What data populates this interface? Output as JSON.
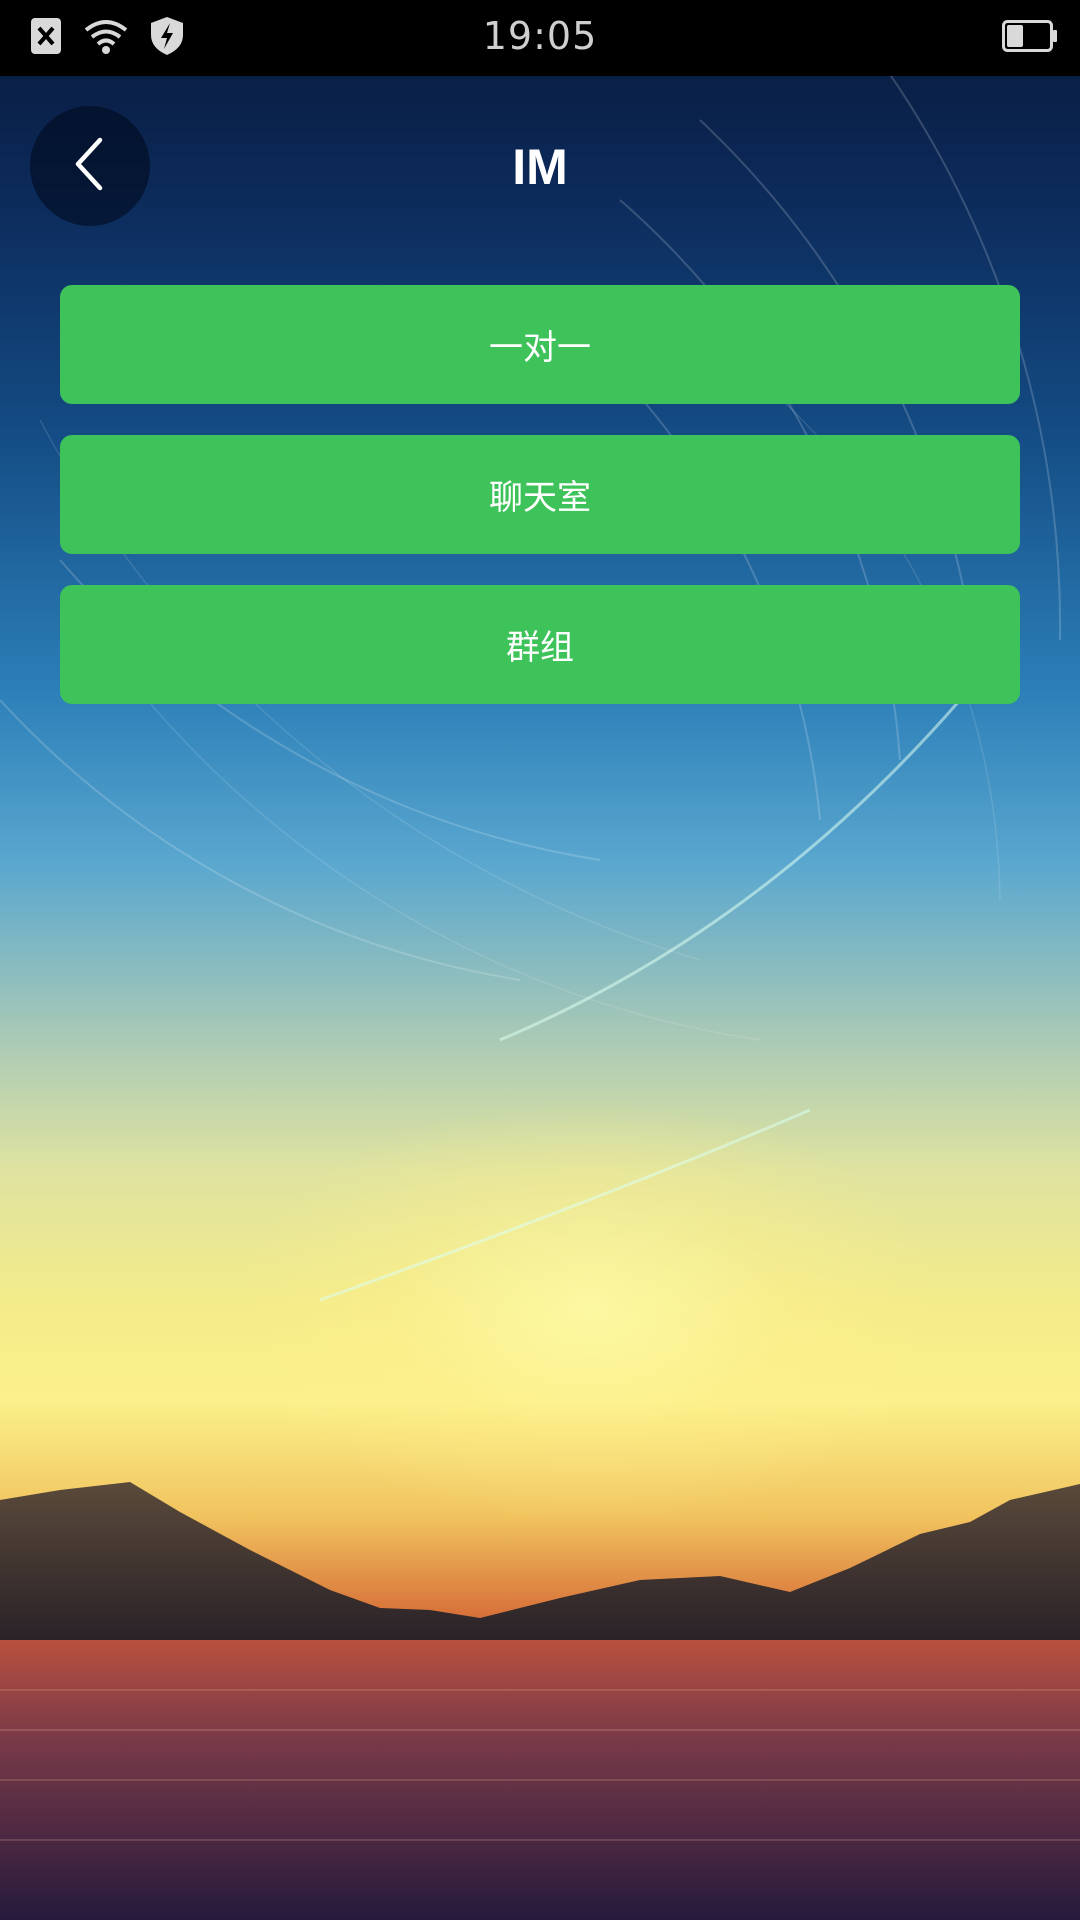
{
  "status_bar": {
    "time": "19:05",
    "icons": [
      "sim-blocked-icon",
      "wifi-icon",
      "shield-bolt-icon",
      "battery-icon"
    ],
    "battery_level": 0.4
  },
  "header": {
    "title": "IM",
    "back_icon": "chevron-left-icon"
  },
  "menu": {
    "items": [
      {
        "label": "一对一"
      },
      {
        "label": "聊天室"
      },
      {
        "label": "群组"
      }
    ]
  },
  "colors": {
    "button": "#3ec35a",
    "status_bar": "#000000",
    "title_text": "#ffffff"
  }
}
